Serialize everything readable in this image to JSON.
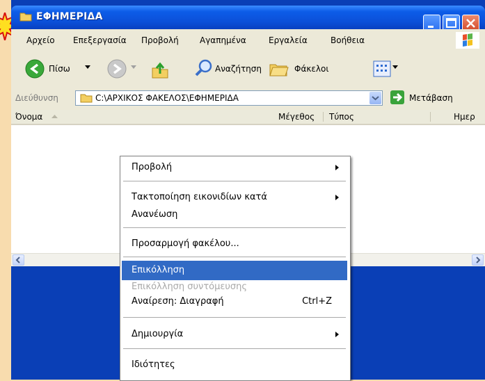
{
  "window": {
    "title": "ΕΦΗΜΕΡΙΔΑ"
  },
  "menubar": {
    "items": [
      "Αρχείο",
      "Επεξεργασία",
      "Προβολή",
      "Αγαπημένα",
      "Εργαλεία",
      "Βοήθεια"
    ]
  },
  "toolbar": {
    "back_label": "Πίσω",
    "search_label": "Αναζήτηση",
    "folders_label": "Φάκελοι"
  },
  "address": {
    "label": "Διεύθυνση",
    "path": "C:\\ΑΡΧΙΚΟΣ ΦΑΚΕΛΟΣ\\ΕΦΗΜΕΡΙΔΑ",
    "go_label": "Μετάβαση"
  },
  "columns": {
    "name": "Όνομα",
    "size": "Μέγεθος",
    "type": "Τύπος",
    "date": "Ημερ"
  },
  "context_menu": {
    "items": [
      {
        "label": "Προβολή"
      },
      {
        "label": "Τακτοποίηση εικονιδίων κατά"
      },
      {
        "label": "Ανανέωση"
      },
      {
        "label": "Προσαρμογή φακέλου..."
      },
      {
        "label": "Επικόλληση"
      },
      {
        "label": "Επικόλληση συντόμευσης"
      },
      {
        "label": "Αναίρεση: Διαγραφή",
        "shortcut": "Ctrl+Z"
      },
      {
        "label": "Δημιουργία"
      },
      {
        "label": "Ιδιότητες"
      }
    ]
  },
  "colors": {
    "titlebar": "#0b4fd8",
    "highlight": "#316ac5",
    "background": "#f8dcae"
  }
}
